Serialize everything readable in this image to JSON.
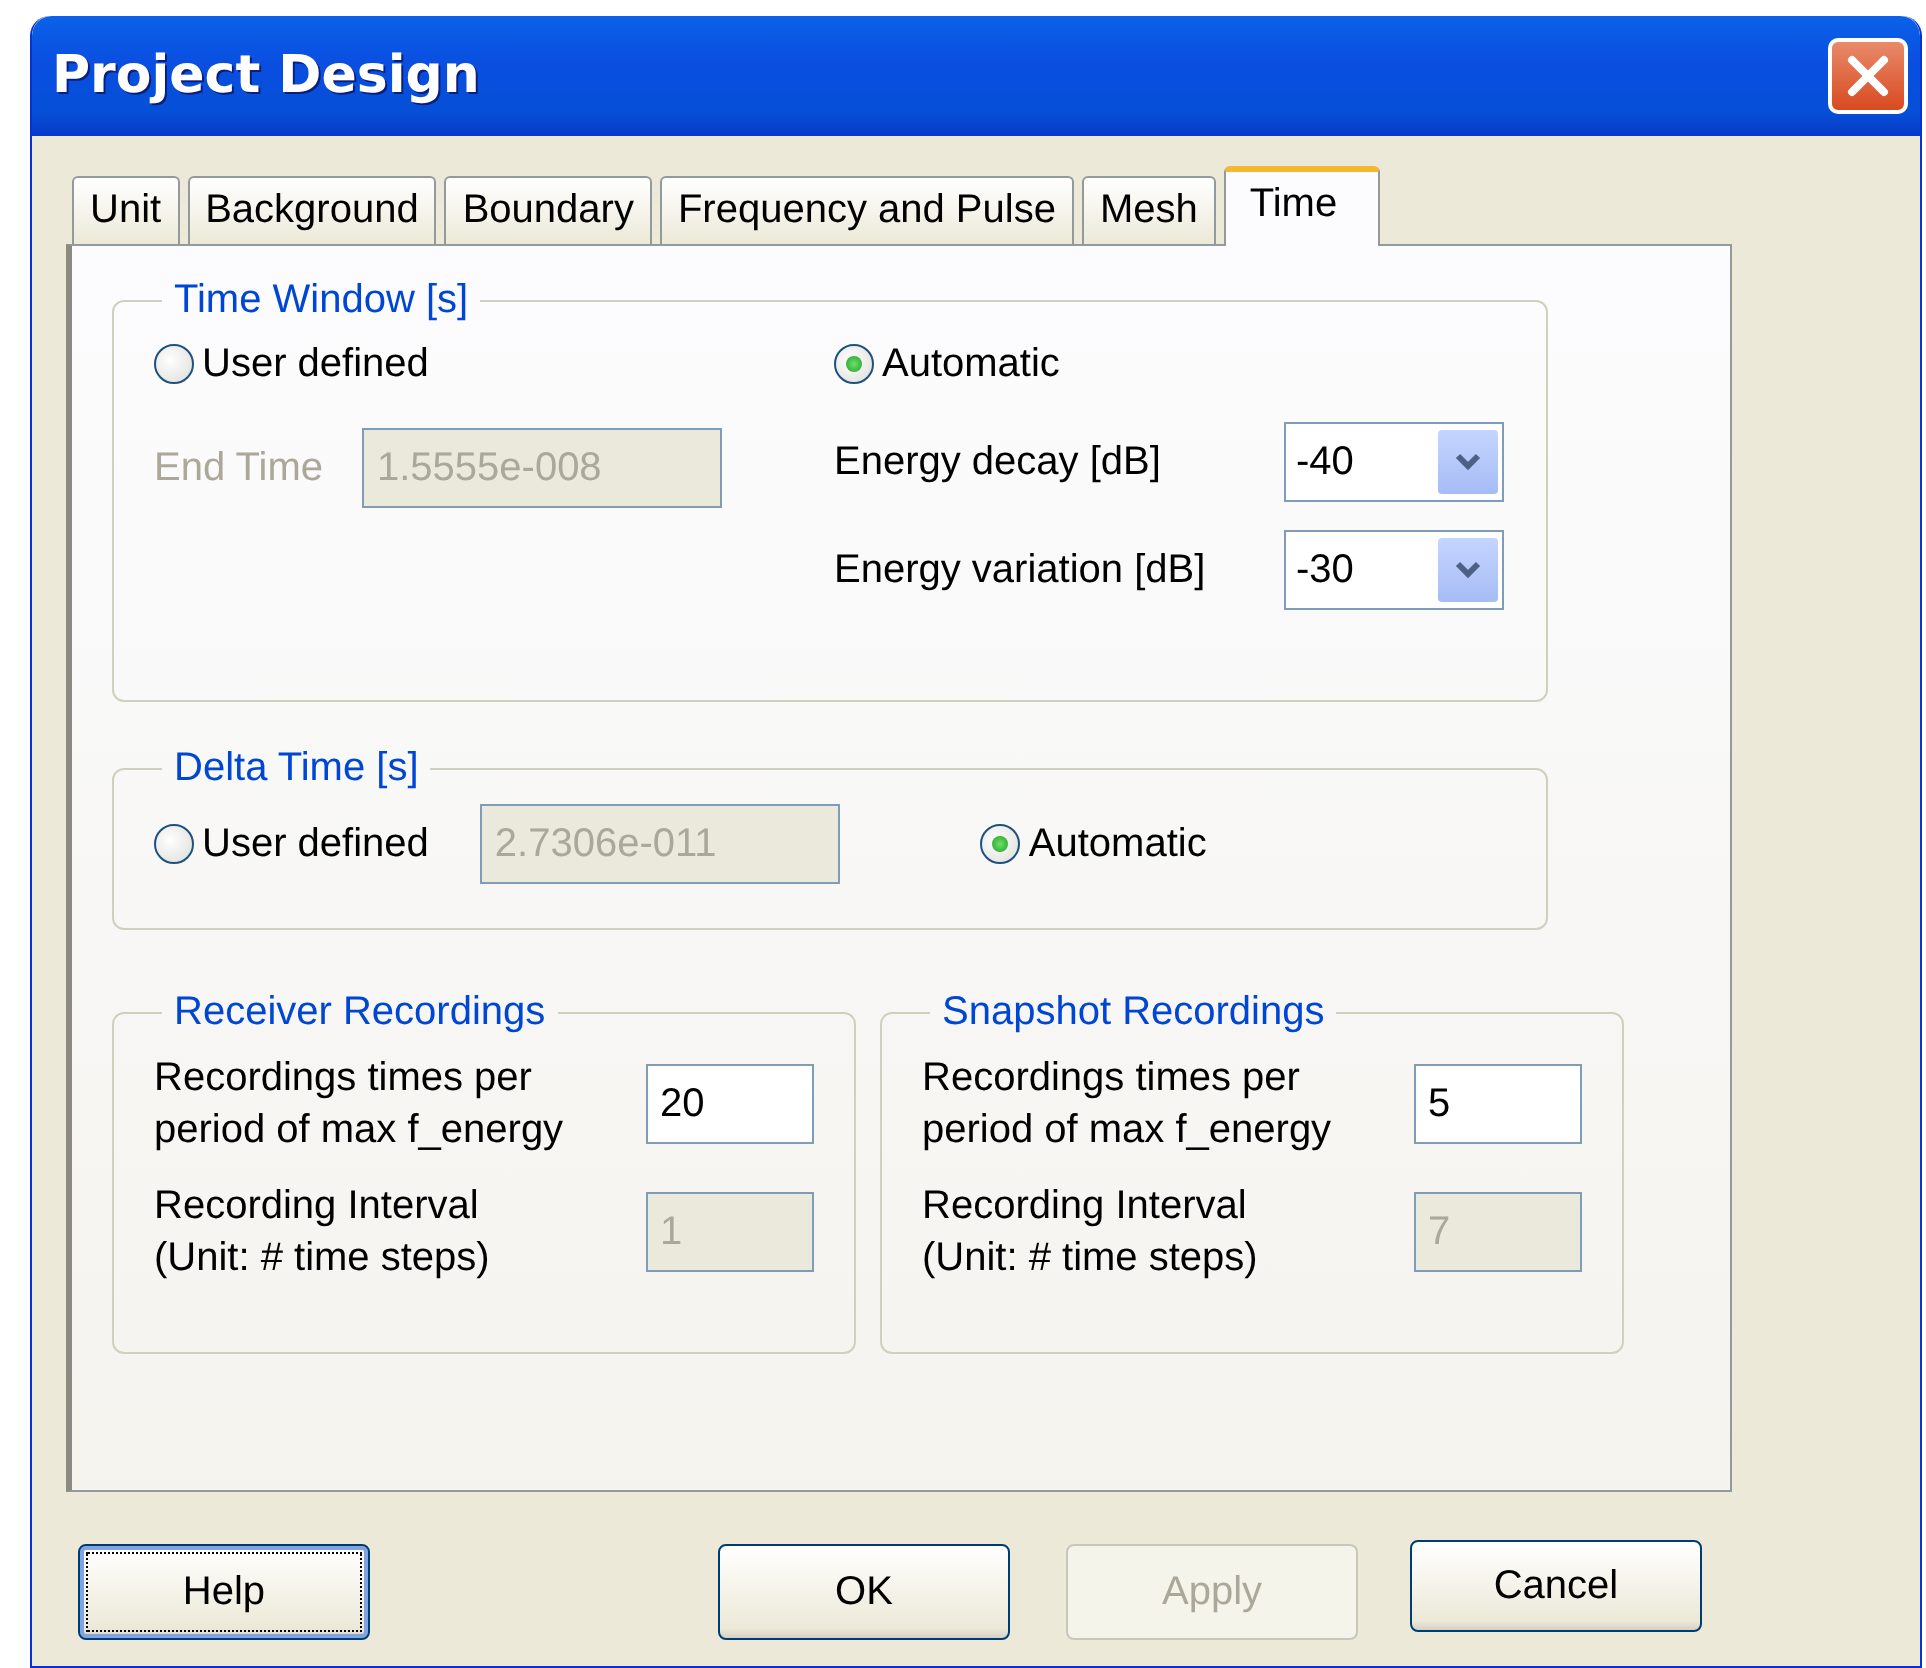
{
  "window": {
    "title": "Project Design"
  },
  "tabs": [
    {
      "label": "Unit",
      "selected": false
    },
    {
      "label": "Background",
      "selected": false
    },
    {
      "label": "Boundary",
      "selected": false
    },
    {
      "label": "Frequency and Pulse",
      "selected": false
    },
    {
      "label": "Mesh",
      "selected": false
    },
    {
      "label": "Time",
      "selected": true
    }
  ],
  "time_window": {
    "title": "Time Window [s]",
    "user_defined": {
      "label": "User defined",
      "selected": false
    },
    "automatic": {
      "label": "Automatic",
      "selected": true
    },
    "end_time": {
      "label": "End Time",
      "value": "1.5555e-008",
      "disabled": true
    },
    "energy_decay": {
      "label": "Energy decay [dB]",
      "value": "-40"
    },
    "energy_variation": {
      "label": "Energy variation [dB]",
      "value": "-30"
    }
  },
  "delta_time": {
    "title": "Delta Time [s]",
    "user_defined": {
      "label": "User defined",
      "selected": false
    },
    "value": {
      "value": "2.7306e-011",
      "disabled": true
    },
    "automatic": {
      "label": "Automatic",
      "selected": true
    }
  },
  "recordings": [
    {
      "title": "Receiver Recordings",
      "times_label": "Recordings times per\nperiod of max f_energy",
      "times_value": "20",
      "interval_label": "Recording Interval\n(Unit: # time steps)",
      "interval_value": "1",
      "interval_disabled": true
    },
    {
      "title": "Snapshot Recordings",
      "times_label": "Recordings times per\nperiod of max f_energy",
      "times_value": "5",
      "interval_label": "Recording Interval\n(Unit: # time steps)",
      "interval_value": "7",
      "interval_disabled": true
    }
  ],
  "buttons": [
    {
      "label": "Help",
      "kind": "help",
      "disabled": false,
      "focused": true
    },
    {
      "label": "OK",
      "kind": "ok",
      "disabled": false,
      "focused": false
    },
    {
      "label": "Apply",
      "kind": "apply",
      "disabled": true,
      "focused": false
    },
    {
      "label": "Cancel",
      "kind": "cancel",
      "disabled": false,
      "focused": false
    }
  ]
}
